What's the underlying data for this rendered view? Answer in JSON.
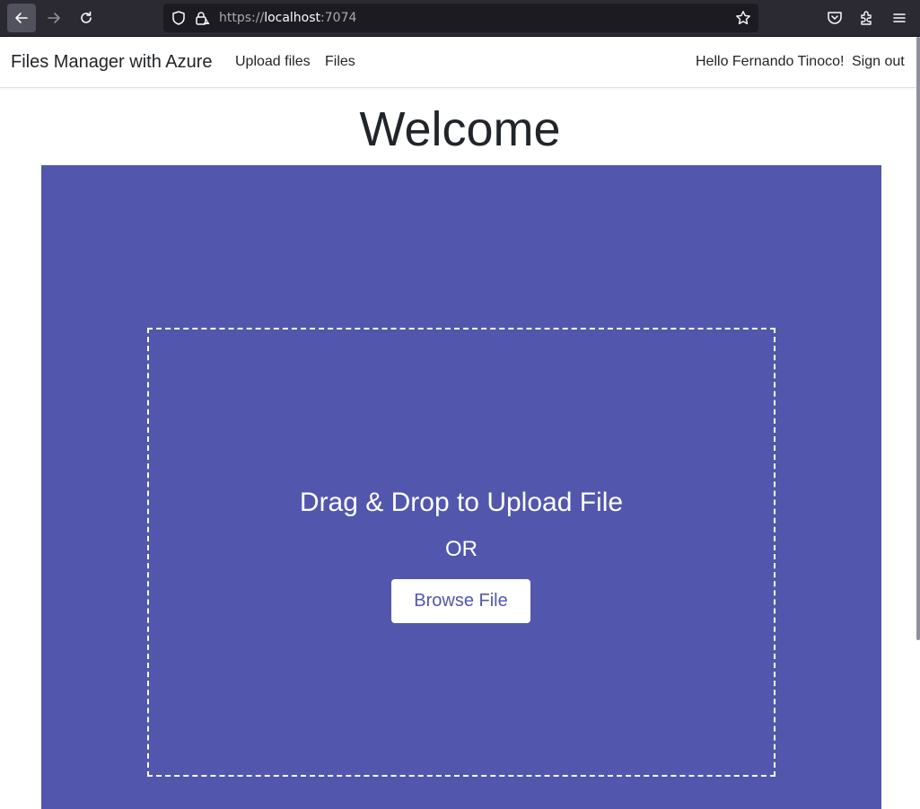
{
  "browser": {
    "url_scheme": "https://",
    "url_host": "localhost",
    "url_port": ":7074",
    "icons": [
      "back-arrow-icon",
      "forward-arrow-icon",
      "reload-icon",
      "shield-icon",
      "insecure-lock-icon",
      "bookmark-star-icon",
      "pocket-icon",
      "extensions-icon",
      "hamburger-menu-icon"
    ]
  },
  "navbar": {
    "brand": "Files Manager with Azure",
    "links": [
      {
        "label": "Upload files"
      },
      {
        "label": "Files"
      }
    ],
    "greeting": "Hello Fernando Tinoco!",
    "signout": "Sign out"
  },
  "main": {
    "heading": "Welcome",
    "dropzone": {
      "title": "Drag & Drop to Upload File",
      "or_text": "OR",
      "browse_label": "Browse File"
    }
  },
  "colors": {
    "panel": "#5257ad",
    "browser_toolbar": "#2b2a33",
    "urlbar": "#1c1b22",
    "text": "#212529"
  }
}
